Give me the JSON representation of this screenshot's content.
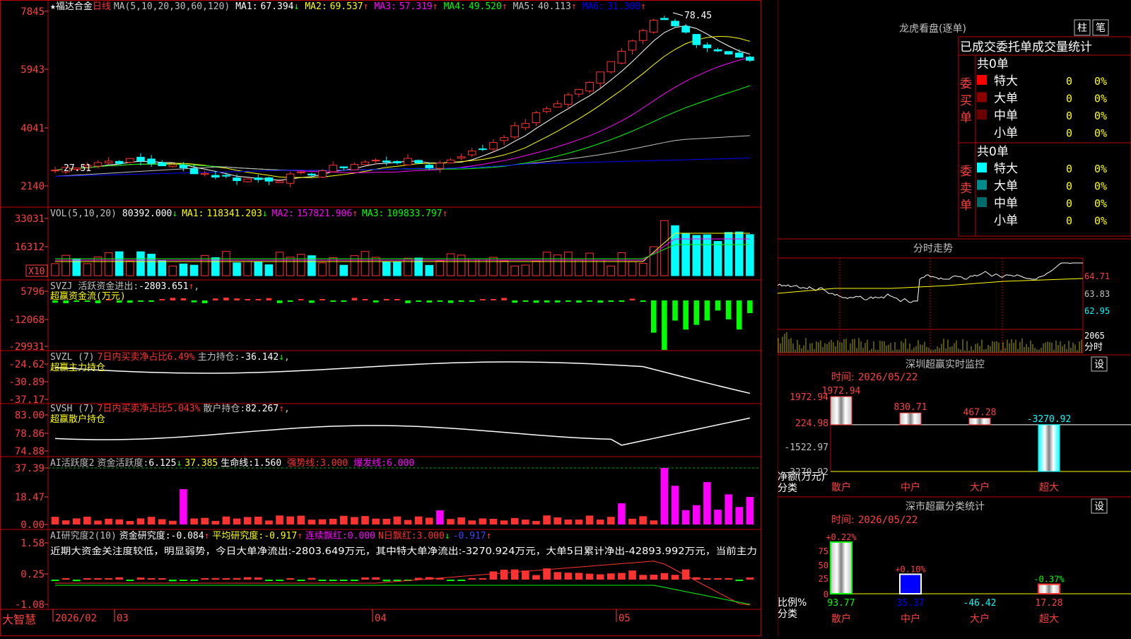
{
  "colors": {
    "up": "#ff3232",
    "down": "#00ffff",
    "ma1": "#ffffff",
    "ma2": "#ffff00",
    "ma3": "#ff00ff",
    "ma4": "#00ff00",
    "ma5": "#c0c0c0",
    "ma6": "#0000ff",
    "frame": "#c00000"
  },
  "stock": {
    "star": "★",
    "name": "福达合金",
    "period": "日线",
    "max_label": "78.45",
    "min_label": "27.51"
  },
  "main": {
    "ma_param": "MA(5,10,20,30,60,120)",
    "ma": [
      {
        "label": "MA1:",
        "value": "67.394",
        "arrow": "↓",
        "color": "#ffffff"
      },
      {
        "label": "MA2:",
        "value": "69.537",
        "arrow": "↑",
        "color": "#ffff00"
      },
      {
        "label": "MA3:",
        "value": "57.319",
        "arrow": "↑",
        "color": "#ff00ff"
      },
      {
        "label": "MA4:",
        "value": "49.520",
        "arrow": "↑",
        "color": "#00ff00"
      },
      {
        "label": "MA5:",
        "value": "40.113",
        "arrow": "↑",
        "color": "#c0c0c0"
      },
      {
        "label": "MA6:",
        "value": "31.308",
        "arrow": "↑",
        "color": "#0000ff"
      }
    ],
    "yticks": [
      "7845",
      "5943",
      "4041",
      "2140"
    ]
  },
  "vol": {
    "param": "VOL(5,10,20)",
    "value": "80392.000",
    "arrow": "↓",
    "ma": [
      {
        "label": "MA1:",
        "value": "118341.203",
        "arrow": "↓",
        "color": "#ffff00"
      },
      {
        "label": "MA2:",
        "value": "157821.906",
        "arrow": "↑",
        "color": "#ff00ff"
      },
      {
        "label": "MA3:",
        "value": "109833.797",
        "arrow": "↑",
        "color": "#00ff00"
      }
    ],
    "yticks": [
      "33031",
      "16312"
    ],
    "unit": "X10"
  },
  "svzj": {
    "name": "SVZJ",
    "title": "活跃资金进出:",
    "value": "-2803.651",
    "arrow": "↑",
    "sep": ",",
    "sub": "超赢资金流(万元)",
    "yticks": [
      "5796",
      "-12068",
      "-29931"
    ]
  },
  "svzl": {
    "name": "SVZL (7)",
    "t1": "7日内买卖净占比6.49%",
    "t2": "主力持仓:",
    "value": "-36.142",
    "arrow": "↓",
    "sep": ",",
    "sub": "超赢主力持仓",
    "yticks": [
      "-24.62",
      "-30.89",
      "-37.17"
    ]
  },
  "svsh": {
    "name": "SVSH (7)",
    "t1": "7日内买卖净占比5.043%",
    "t2": "散户持仓:",
    "value": "82.267",
    "arrow": "↑",
    "sep": ",",
    "sub": "超赢散户持仓",
    "yticks": [
      "83.00",
      "78.86",
      "74.88"
    ]
  },
  "ai1": {
    "name": "AI活跃度2",
    "t1": "资金活跃度:",
    "v1": "6.125",
    "a1": "↓",
    "v2": "37.385",
    "t3": "生命线:",
    "v3": "1.560",
    "t4": "强势线:",
    "v4": "3.000",
    "t5": "爆发线:",
    "v5": "6.000",
    "yticks": [
      "37.39",
      "18.47",
      "0.00"
    ]
  },
  "ai2": {
    "name": "AI研究度2(10)",
    "t1": "资金研究度:",
    "v1": "-0.084",
    "a1": "↑",
    "t2": "平均研究度:",
    "v2": "-0.917",
    "a2": "↑",
    "t3": "连续飘红:",
    "v3": "0.000",
    "t4": "N日飘红:",
    "v4": "3.000",
    "a4": "↓",
    "v5": "-0.917",
    "a5": "↑",
    "comment": "近期大资金关注度较低，明显弱势，今日大单净流出:-2803.649万元，其中特大单净流出:-3270.924万元，大单5日累计净出-42893.992万元，当前主力",
    "yticks": [
      "1.58",
      "0.25",
      "-1.08"
    ]
  },
  "xaxis": {
    "brand": "大智慧",
    "labels": [
      "2026/02",
      "03",
      "04",
      "05"
    ]
  },
  "longhu": {
    "title": "龙虎看盘(逐单)",
    "btn_zhu": "柱",
    "btn_zhe": "笔",
    "tabs": [
      "已成交委托单成交量统计"
    ],
    "buy": {
      "side": "委买单",
      "total": "共0单",
      "rows": [
        {
          "color": "#ff0000",
          "label": "特大",
          "count": "0",
          "pct": "0%"
        },
        {
          "color": "#8b0000",
          "label": "大单",
          "count": "0",
          "pct": "0%"
        },
        {
          "color": "#6b0000",
          "label": "中单",
          "count": "0",
          "pct": "0%"
        },
        {
          "color": "#000000",
          "label": "小单",
          "count": "0",
          "pct": "0%"
        }
      ]
    },
    "sell": {
      "side": "委卖单",
      "total": "共0单",
      "rows": [
        {
          "color": "#00ffff",
          "label": "特大",
          "count": "0",
          "pct": "0%"
        },
        {
          "color": "#008b8b",
          "label": "大单",
          "count": "0",
          "pct": "0%"
        },
        {
          "color": "#006b6b",
          "label": "中单",
          "count": "0",
          "pct": "0%"
        },
        {
          "color": "#000000",
          "label": "小单",
          "count": "0",
          "pct": "0%"
        }
      ]
    }
  },
  "fenshi": {
    "title": "分时走势",
    "prices": [
      "64.71",
      "63.83",
      "62.95"
    ],
    "vol": "2065",
    "vol_label": "分时"
  },
  "monitor": {
    "title": "深圳超赢实时监控",
    "btn": "设",
    "time_label": "时间:",
    "time": "2026/05/22",
    "unit": "净额(万元)",
    "cat_label": "分类",
    "yticks": [
      "1972.94",
      "224.98",
      "-1522.97",
      "-3270.92"
    ]
  },
  "classify": {
    "title": "深市超赢分类统计",
    "btn": "设",
    "time_label": "时间:",
    "time": "2026/05/22",
    "unit": "比例%",
    "cat_label": "分类",
    "yticks": [
      "75",
      "50",
      "25",
      "0"
    ]
  },
  "chart_data": [
    {
      "type": "bar",
      "title": "深圳超赢实时监控",
      "categories": [
        "散户",
        "中户",
        "大户",
        "超大"
      ],
      "values": [
        1972.94,
        830.71,
        467.28,
        -3270.92
      ],
      "ylabel": "净额(万元)",
      "ylim": [
        -3270.92,
        1972.94
      ]
    },
    {
      "type": "bar",
      "title": "深市超赢分类统计",
      "categories": [
        "散户",
        "中户",
        "大户",
        "超大"
      ],
      "series": [
        {
          "values": [
            93.77,
            35.37,
            -46.42,
            17.28
          ]
        },
        {
          "values": [
            0.22,
            0.1,
            0,
            -0.37
          ]
        }
      ],
      "top_labels": [
        "+0.22%",
        "+0.10%",
        "",
        "-0.37%"
      ],
      "ylabel": "比例%",
      "ylim": [
        0,
        100
      ]
    }
  ]
}
